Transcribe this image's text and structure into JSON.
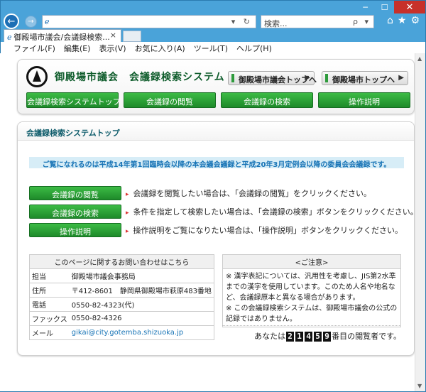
{
  "browser": {
    "minimize": "─",
    "maximize": "☐",
    "close": "✕",
    "back": "←",
    "forward": "→",
    "address_value": "",
    "address_controls": "▾ ↻",
    "search_placeholder": "検索...",
    "search_controls": "ρ ▾",
    "tab_title": "御殿場市議会/会議録検索...",
    "tab_close": "×",
    "menu": [
      "ファイル(F)",
      "編集(E)",
      "表示(V)",
      "お気に入り(A)",
      "ツール(T)",
      "ヘルプ(H)"
    ]
  },
  "header": {
    "site_title": "御殿場市議会　会議録検索システム",
    "link_gikai": "御殿場市議会トップへ",
    "link_city": "御殿場市トップへ",
    "link_arrow": "▶",
    "nav": [
      "会議録検索システムトップ",
      "会議録の閲覧",
      "会議録の検索",
      "操作説明"
    ]
  },
  "main": {
    "heading": "会議録検索システムトップ",
    "notice": "ご覧になれるのは平成14年第1回臨時会以降の本会議会議録と平成20年3月定例会以降の委員会会議録です。",
    "actions": [
      {
        "label": "会議録の閲覧",
        "desc": "会議録を閲覧したい場合は、「会議録の閲覧」をクリックください。"
      },
      {
        "label": "会議録の検索",
        "desc": "条件を指定して検索したい場合は、「会議録の検索」ボタンをクリックください。"
      },
      {
        "label": "操作説明",
        "desc": "操作説明をご覧になりたい場合は、「操作説明」ボタンをクリックください。"
      }
    ],
    "contact": {
      "caption": "このページに関するお問い合わせはこちら",
      "rows": [
        {
          "key": "担当",
          "value": "御殿場市議会事務局"
        },
        {
          "key": "住所",
          "value": "〒412-8601　静岡県御殿場市萩原483番地"
        },
        {
          "key": "電話",
          "value": "0550-82-4323(代)"
        },
        {
          "key": "ファックス",
          "value": "0550-82-4326"
        },
        {
          "key": "メール",
          "value": "gikai@city.gotemba.shizuoka.jp"
        }
      ]
    },
    "caution": {
      "caption": "<ご注意>",
      "lines": [
        "※ 漢字表記については、汎用性を考慮し、JIS第2水準までの漢字を使用しています。このため人名や地名など、会議録原本と異なる場合があります。",
        "※ この会議録検索システムは、御殿場市議会の公式の記録ではありません。"
      ]
    },
    "counter": {
      "prefix": "あなたは",
      "digits": [
        "2",
        "1",
        "4",
        "5",
        "9"
      ],
      "suffix": "番目の閲覧者です。"
    }
  }
}
